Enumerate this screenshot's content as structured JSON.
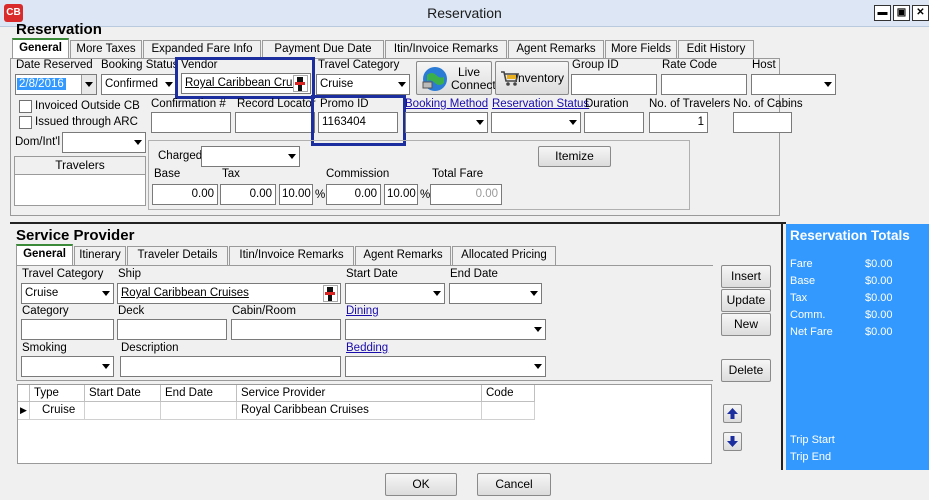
{
  "window": {
    "title": "Reservation",
    "logo": "CB",
    "min": "▬",
    "max": "▣",
    "close": "✕"
  },
  "reservation": {
    "section_title": "Reservation",
    "tabs": [
      "General",
      "More Taxes",
      "Expanded Fare Info",
      "Payment Due Date",
      "Itin/Invoice Remarks",
      "Agent Remarks",
      "More Fields",
      "Edit History"
    ],
    "date_reserved_label": "Date Reserved",
    "date_reserved": "2/8/2016",
    "booking_status_label": "Booking Status",
    "booking_status": "Confirmed",
    "vendor_label": "Vendor",
    "vendor": "Royal Caribbean Cruise",
    "travel_category_label": "Travel Category",
    "travel_category": "Cruise",
    "live_connect": "Live Connect",
    "inventory": "Inventory",
    "group_id_label": "Group ID",
    "rate_code_label": "Rate Code",
    "host_label": "Host",
    "invoiced_outside": "Invoiced Outside CB",
    "issued_arc": "Issued through ARC",
    "dom_intl_label": "Dom/Int'l",
    "travelers_header": "Travelers",
    "confirmation_label": "Confirmation #",
    "record_locator_label": "Record Locator",
    "promo_id_label": "Promo ID",
    "promo_id": "1163404",
    "booking_method_label": "Booking Method",
    "reservation_status_label": "Reservation Status",
    "duration_label": "Duration",
    "num_travelers_label": "No. of Travelers",
    "num_travelers": "1",
    "num_cabins_label": "No. of Cabins",
    "charged_label": "Charged",
    "itemize": "Itemize",
    "base_label": "Base",
    "base": "0.00",
    "tax_label": "Tax",
    "tax": "0.00",
    "tax_pct": "10.00",
    "commission_label": "Commission",
    "commission": "0.00",
    "commission_pct": "10.00",
    "pct_sign": "%",
    "total_fare_label": "Total Fare",
    "total_fare": "0.00"
  },
  "service_provider": {
    "section_title": "Service Provider",
    "tabs": [
      "General",
      "Itinerary",
      "Traveler Details",
      "Itin/Invoice Remarks",
      "Agent Remarks",
      "Allocated Pricing"
    ],
    "travel_category_label": "Travel Category",
    "travel_category": "Cruise",
    "ship_label": "Ship",
    "ship": "Royal Caribbean Cruises",
    "start_date_label": "Start Date",
    "end_date_label": "End Date",
    "category_label": "Category",
    "deck_label": "Deck",
    "cabin_label": "Cabin/Room",
    "dining_label": "Dining",
    "smoking_label": "Smoking",
    "description_label": "Description",
    "bedding_label": "Bedding",
    "buttons": {
      "insert": "Insert",
      "update": "Update",
      "new": "New",
      "delete": "Delete"
    },
    "grid": {
      "columns": [
        "Type",
        "Start Date",
        "End Date",
        "Service Provider",
        "Code"
      ],
      "rows": [
        {
          "type": "Cruise",
          "start": "",
          "end": "",
          "provider": "Royal Caribbean Cruises",
          "code": ""
        }
      ]
    }
  },
  "totals": {
    "title": "Reservation Totals",
    "rows": [
      {
        "label": "Fare",
        "value": "$0.00"
      },
      {
        "label": "Base",
        "value": "$0.00"
      },
      {
        "label": "Tax",
        "value": "$0.00"
      },
      {
        "label": "Comm.",
        "value": "$0.00"
      },
      {
        "label": "Net Fare",
        "value": "$0.00"
      }
    ],
    "trip_start": "Trip Start",
    "trip_end": "Trip End"
  },
  "footer": {
    "ok": "OK",
    "cancel": "Cancel"
  },
  "colors": {
    "highlight": "#1c2e9e",
    "totals_bg": "#3399ff",
    "link": "#1a0dab"
  }
}
